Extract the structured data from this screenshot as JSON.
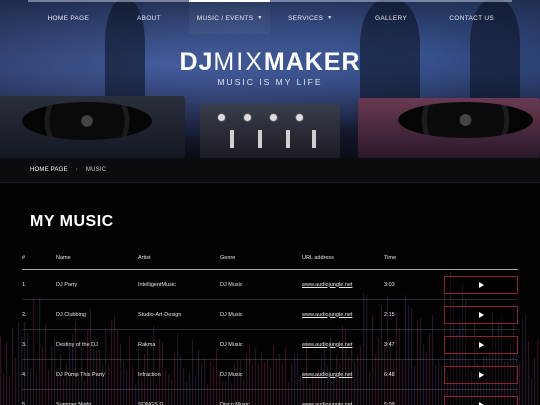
{
  "nav": {
    "items": [
      {
        "label": "Home Page",
        "active": false,
        "dropdown": false
      },
      {
        "label": "About",
        "active": false,
        "dropdown": false
      },
      {
        "label": "Music / Events",
        "active": true,
        "dropdown": true
      },
      {
        "label": "Services",
        "active": false,
        "dropdown": true
      },
      {
        "label": "Gallery",
        "active": false,
        "dropdown": false
      },
      {
        "label": "Contact Us",
        "active": false,
        "dropdown": false
      }
    ],
    "caret_icon": "chevron-down-icon"
  },
  "logo": {
    "dj": "DJ",
    "mix": "MIX",
    "maker": "MAKER",
    "tagline": "MUSIC IS MY LIFE"
  },
  "breadcrumb": {
    "home": "HOME PAGE",
    "separator": "›",
    "current": "MUSIC"
  },
  "page_title": "MY MUSIC",
  "table": {
    "headers": {
      "num": "#",
      "name": "Name",
      "artist": "Artist",
      "genre": "Genre",
      "url": "URL address",
      "time": "Time"
    },
    "rows": [
      {
        "num": "1.",
        "name": "DJ Party",
        "artist": "IntelligentMusic",
        "genre": "DJ Music",
        "url": "www.audiojungle.net",
        "time": "3:03"
      },
      {
        "num": "2.",
        "name": "DJ Clubbing",
        "artist": "Studio-Art-Design",
        "genre": "DJ Music",
        "url": "www.audiojungle.net",
        "time": "2:15"
      },
      {
        "num": "3.",
        "name": "Destiny of the DJ",
        "artist": "Rakma",
        "genre": "DJ Music",
        "url": "www.audiojungle.net",
        "time": "3:47"
      },
      {
        "num": "4.",
        "name": "DJ Pump This Party",
        "artist": "Infraction",
        "genre": "DJ Music",
        "url": "www.audiojungle.net",
        "time": "6:48"
      },
      {
        "num": "5.",
        "name": "Summer Night",
        "artist": "SONGS D...",
        "genre": "Disco Music",
        "url": "www.audiojungle.net",
        "time": "5:09"
      }
    ],
    "play_icon": "play-icon"
  },
  "colors": {
    "accent_border": "#8a2230",
    "background": "#000000"
  }
}
